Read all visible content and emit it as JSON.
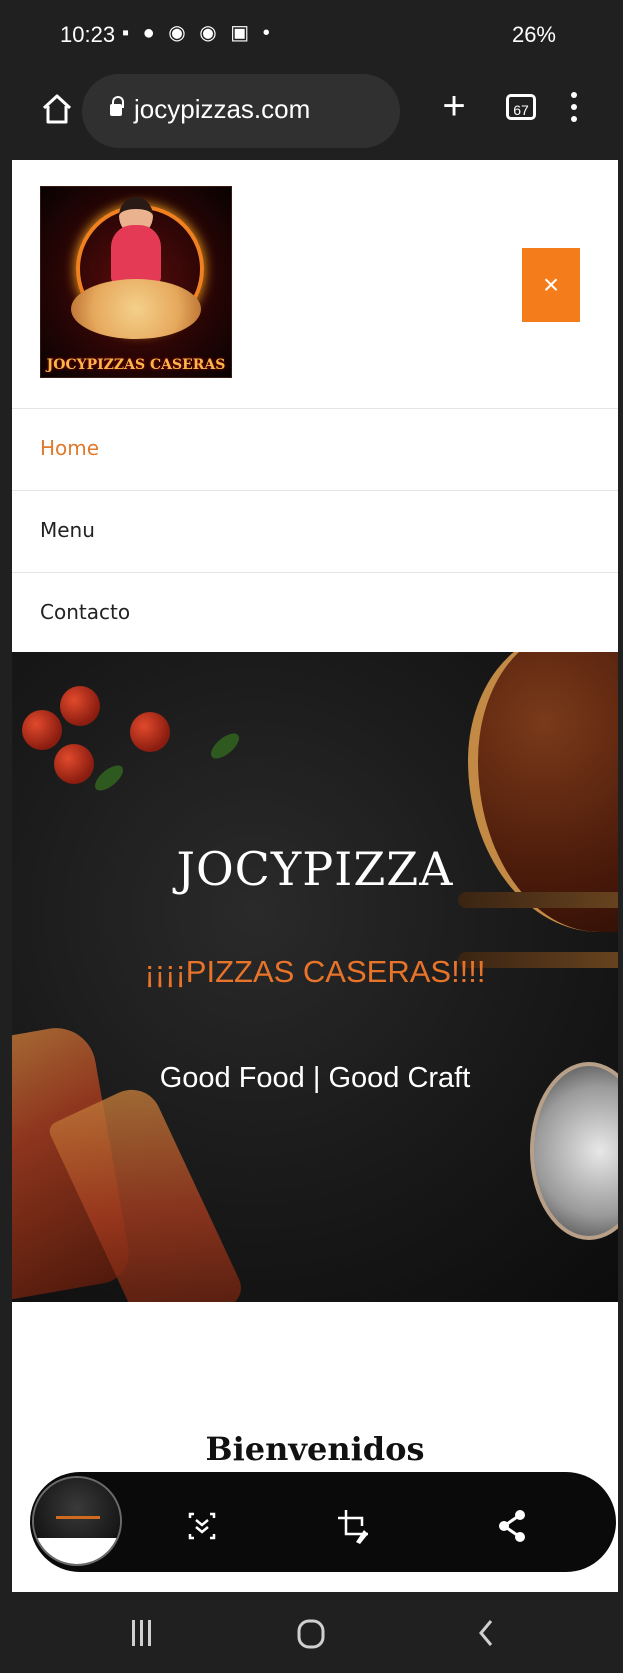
{
  "status_bar": {
    "time": "10:23",
    "battery": "26%",
    "battery_level_percent": 26
  },
  "browser": {
    "url": "jocypizzas.com",
    "tab_count": "67"
  },
  "site": {
    "logo_caption": "JOCYPIZZAS CASERAS",
    "close_label": "×",
    "nav": [
      {
        "label": "Home",
        "active": true
      },
      {
        "label": "Menu",
        "active": false
      },
      {
        "label": "Contacto",
        "active": false
      }
    ],
    "hero": {
      "title": "JOCYPIZZA",
      "subtitle": "¡¡¡¡PIZZAS CASERAS!!!!",
      "tagline": "Good Food | Good Craft"
    },
    "welcome_title": "Bienvenidos"
  },
  "colors": {
    "accent": "#f47c1a",
    "nav_active": "#e07a2c",
    "hero_subtitle": "#e8742a"
  },
  "icons": {
    "scroll_capture": "scroll-capture-icon",
    "crop_edit": "crop-edit-icon",
    "share": "share-icon"
  }
}
